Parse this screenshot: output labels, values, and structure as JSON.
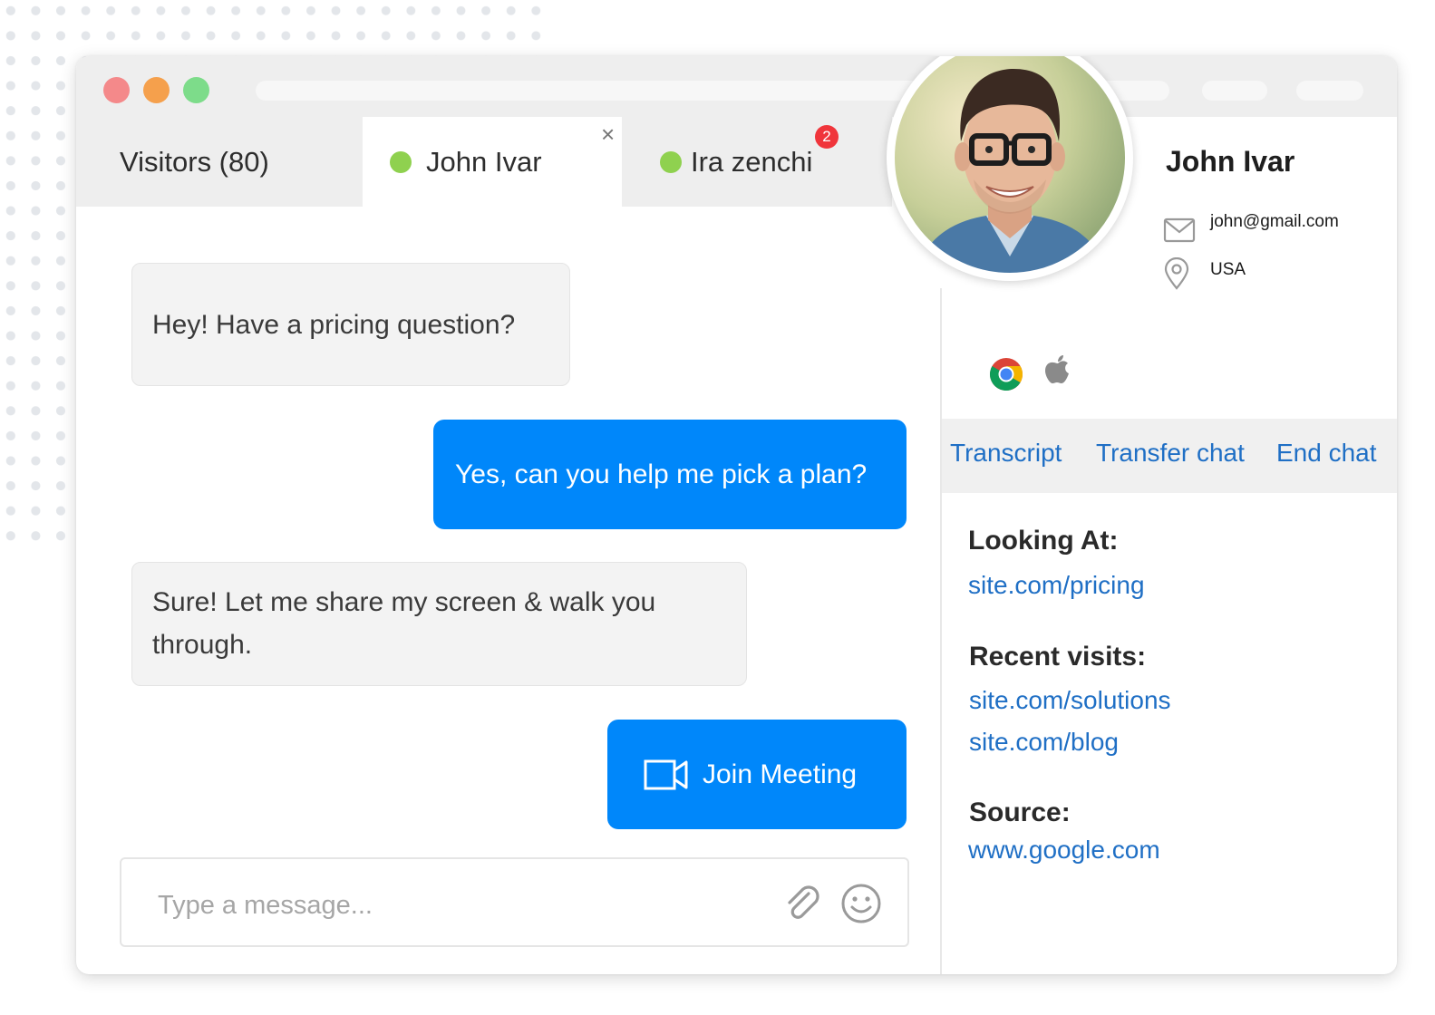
{
  "tabs": {
    "visitors_label": "Visitors (80)",
    "active_label": "John Ivar",
    "other_label": "Ira zenchi",
    "other_badge": "2",
    "close_glyph": "×"
  },
  "messages": [
    {
      "from": "visitor",
      "text": "Hey! Have a pricing question?"
    },
    {
      "from": "agent",
      "text": "Yes, can you help me pick a plan?"
    },
    {
      "from": "visitor",
      "text": "Sure! Let me share my screen & walk you through."
    },
    {
      "from": "agent",
      "text": "Join Meeting",
      "icon": "video-camera-icon"
    }
  ],
  "composer": {
    "placeholder": "Type a message...",
    "icons": [
      "paperclip-icon",
      "emoji-icon"
    ]
  },
  "profile": {
    "name": "John Ivar",
    "email": "john@gmail.com",
    "location": "USA",
    "browser_icon": "chrome-icon",
    "os_icon": "apple-icon"
  },
  "actions": {
    "transcript": "Transcript",
    "transfer": "Transfer chat",
    "end": "End chat"
  },
  "details": {
    "looking_at_label": "Looking At:",
    "looking_at_url": "site.com/pricing",
    "recent_label": "Recent visits:",
    "recent": [
      "site.com/solutions",
      "site.com/blog"
    ],
    "source_label": "Source:",
    "source_url": "www.google.com"
  },
  "colors": {
    "accent_blue": "#0087fa",
    "link_blue": "#1f6fc5",
    "online_green": "#8fd14f",
    "badge_red": "#f0353b",
    "traffic_red": "#f4898a",
    "traffic_orange": "#f5a04c",
    "traffic_green": "#7ddc8a"
  }
}
